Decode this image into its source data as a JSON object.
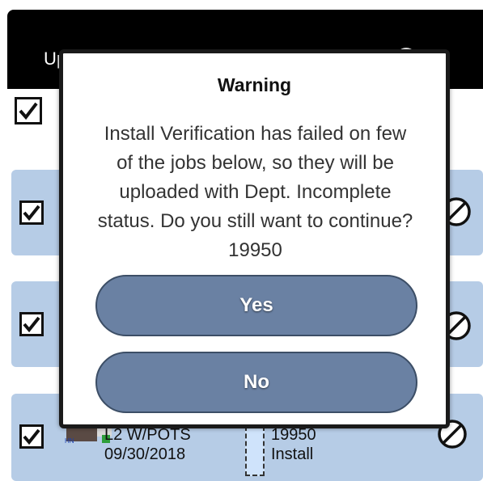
{
  "header": {
    "title": "Upload Info"
  },
  "jobs": [
    {
      "line1": "",
      "line2": ""
    },
    {
      "line1": "",
      "line2": ""
    },
    {
      "line1": "L2 W/POTS",
      "line2": "09/30/2018",
      "id": "19950",
      "type": "Install"
    }
  ],
  "modal": {
    "title": "Warning",
    "message_lines": [
      "Install Verification has failed on few",
      "of the jobs below, so they will be",
      "uploaded with Dept. Incomplete",
      "status. Do you still want to continue?",
      "19950"
    ],
    "yes_label": "Yes",
    "no_label": "No"
  },
  "colors": {
    "header_bg": "#000000",
    "card_bg": "#b6cce6",
    "button_bg": "#6a81a3"
  },
  "icons": [
    "check-icon",
    "cancel-circle-icon",
    "checkmark-check-icon"
  ]
}
